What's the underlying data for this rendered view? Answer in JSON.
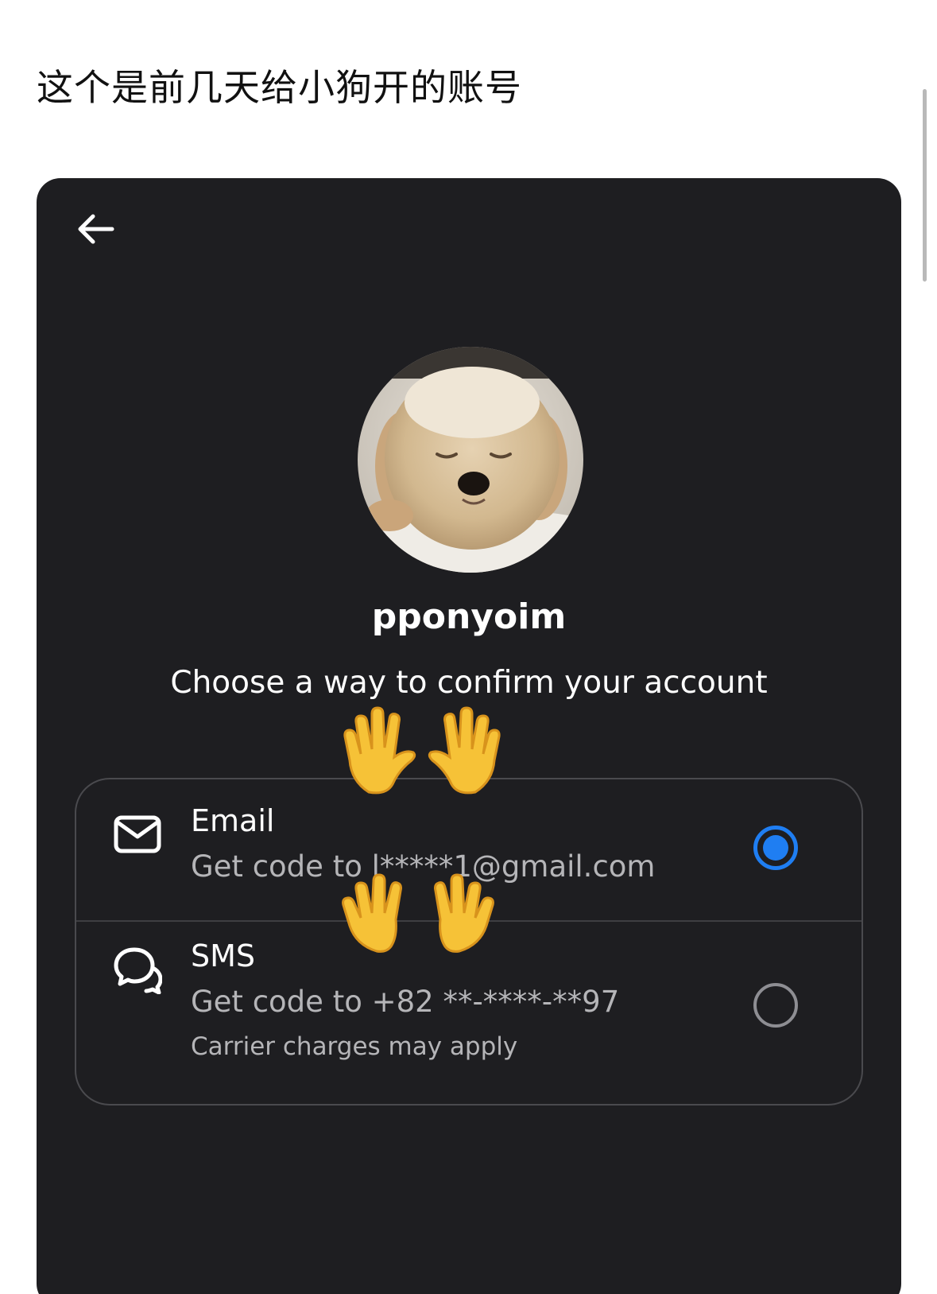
{
  "caption": "这个是前几天给小狗开的账号",
  "header": {
    "back_icon": "arrow-left-icon"
  },
  "profile": {
    "avatar": "puppy-avatar",
    "username": "pponyoim"
  },
  "subtitle": "Choose a way to confirm your account",
  "options": [
    {
      "icon": "envelope-icon",
      "title": "Email",
      "detail": "Get code to l*****1@gmail.com",
      "selected": true
    },
    {
      "icon": "chat-bubbles-icon",
      "title": "SMS",
      "detail": "Get code to +82 **-****-**97",
      "note": "Carrier charges may apply",
      "selected": false
    }
  ],
  "colors": {
    "panel_bg": "#1e1e21",
    "accent": "#1f7ef2",
    "muted_text": "#b5b5b8",
    "border": "#4a4a4e"
  },
  "stickers": [
    "raised-hands-emoji",
    "waving-hands-emoji"
  ]
}
